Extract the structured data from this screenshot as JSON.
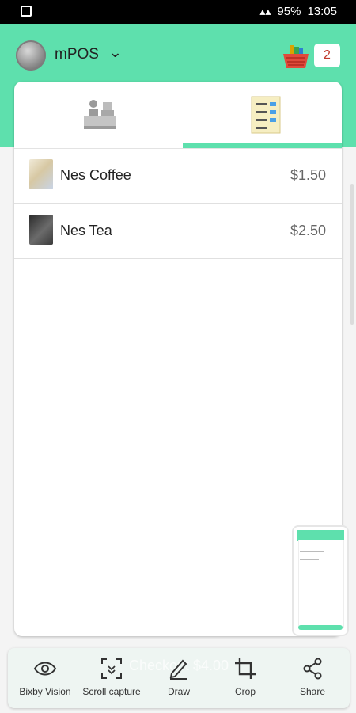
{
  "status_bar": {
    "battery": "95%",
    "time": "13:05"
  },
  "header": {
    "app_name": "mPOS",
    "cart_count": "2"
  },
  "tabs": [
    {
      "icon": "cash-register-icon"
    },
    {
      "icon": "order-list-icon",
      "active": true
    }
  ],
  "products": [
    {
      "name": "Nes Coffee",
      "price": "$1.50"
    },
    {
      "name": "Nes Tea",
      "price": "$2.50"
    }
  ],
  "checkout": {
    "label": "Checkout $4.00"
  },
  "screenshot_toolbar": [
    {
      "icon": "eye-icon",
      "label": "Bixby Vision"
    },
    {
      "icon": "scroll-capture-icon",
      "label": "Scroll capture"
    },
    {
      "icon": "pen-icon",
      "label": "Draw"
    },
    {
      "icon": "crop-icon",
      "label": "Crop"
    },
    {
      "icon": "share-icon",
      "label": "Share"
    }
  ],
  "colors": {
    "accent": "#5ee0ad",
    "badge_text": "#c0392b"
  }
}
